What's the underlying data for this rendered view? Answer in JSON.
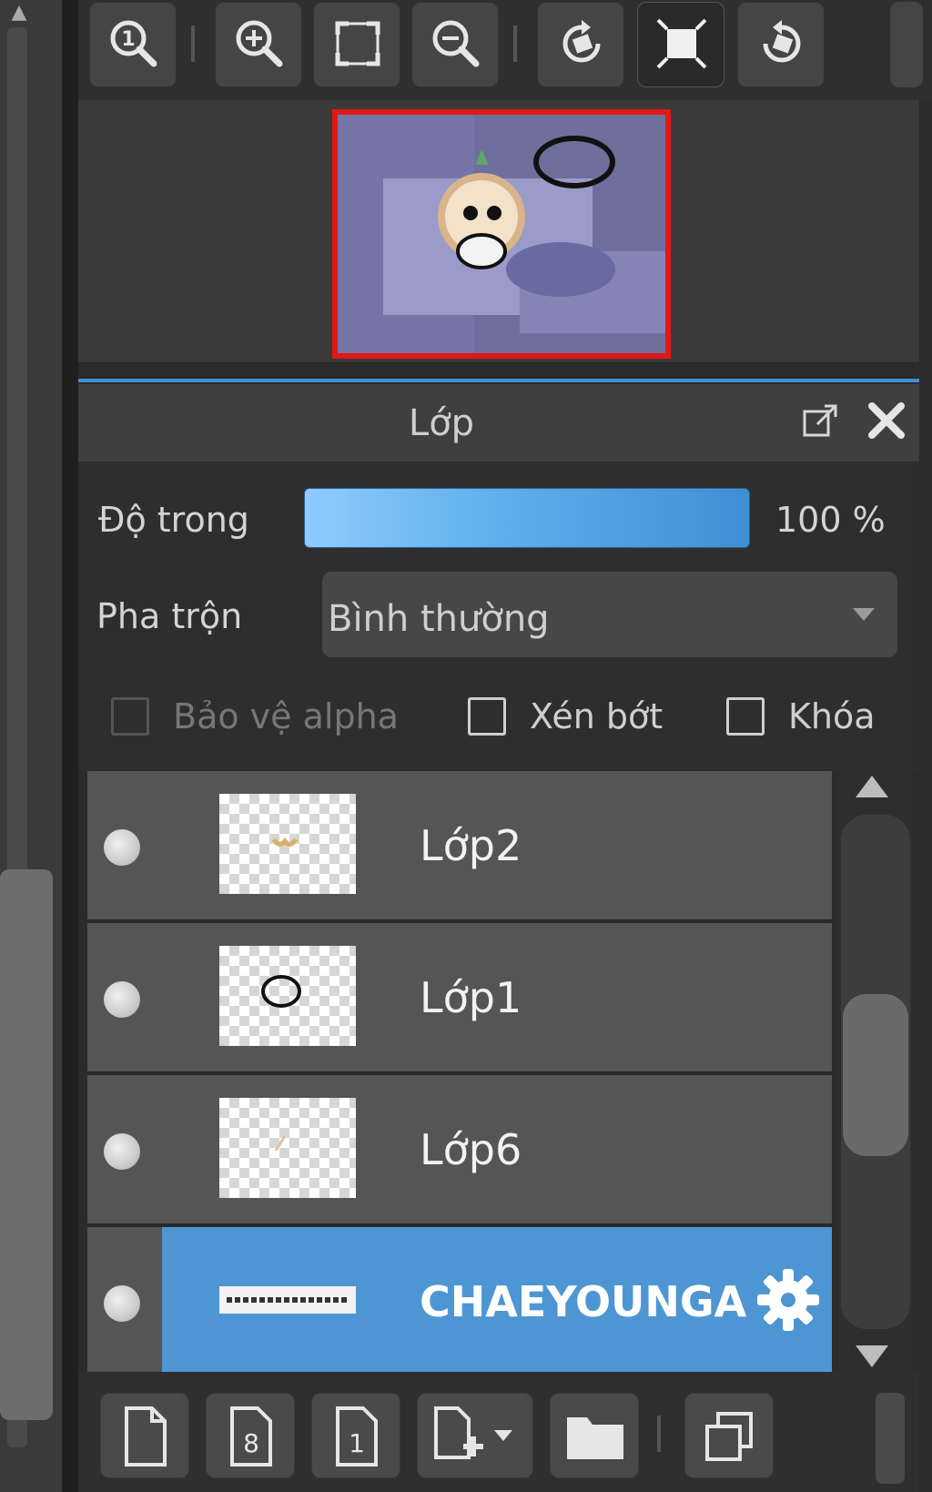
{
  "navigator": {
    "toolbar": [
      {
        "name": "zoom-actual-size-icon"
      },
      {
        "name": "zoom-in-icon"
      },
      {
        "name": "fit-screen-icon"
      },
      {
        "name": "zoom-out-icon"
      },
      {
        "name": "rotate-left-icon"
      },
      {
        "name": "frame-selected-icon"
      },
      {
        "name": "rotate-right-icon"
      }
    ]
  },
  "layer_panel": {
    "title": "Lớp",
    "opacity_label": "Độ trong",
    "opacity_value": "100 %",
    "opacity_fraction": 1.0,
    "blend_label": "Pha trộn",
    "blend_value": "Bình thường",
    "checkboxes": {
      "protect_alpha": {
        "label": "Bảo vệ alpha",
        "checked": false,
        "enabled": false
      },
      "clipping": {
        "label": "Xén bớt",
        "checked": false,
        "enabled": true
      },
      "lock": {
        "label": "Khóa",
        "checked": false,
        "enabled": true
      }
    },
    "layers": [
      {
        "name": "Lớp2",
        "selected": false
      },
      {
        "name": "Lớp1",
        "selected": false
      },
      {
        "name": "Lớp6",
        "selected": false
      },
      {
        "name": "CHAEYOUNGA",
        "selected": true
      }
    ]
  },
  "colors": {
    "accent": "#4e96d3",
    "frame_red": "#e51616"
  }
}
